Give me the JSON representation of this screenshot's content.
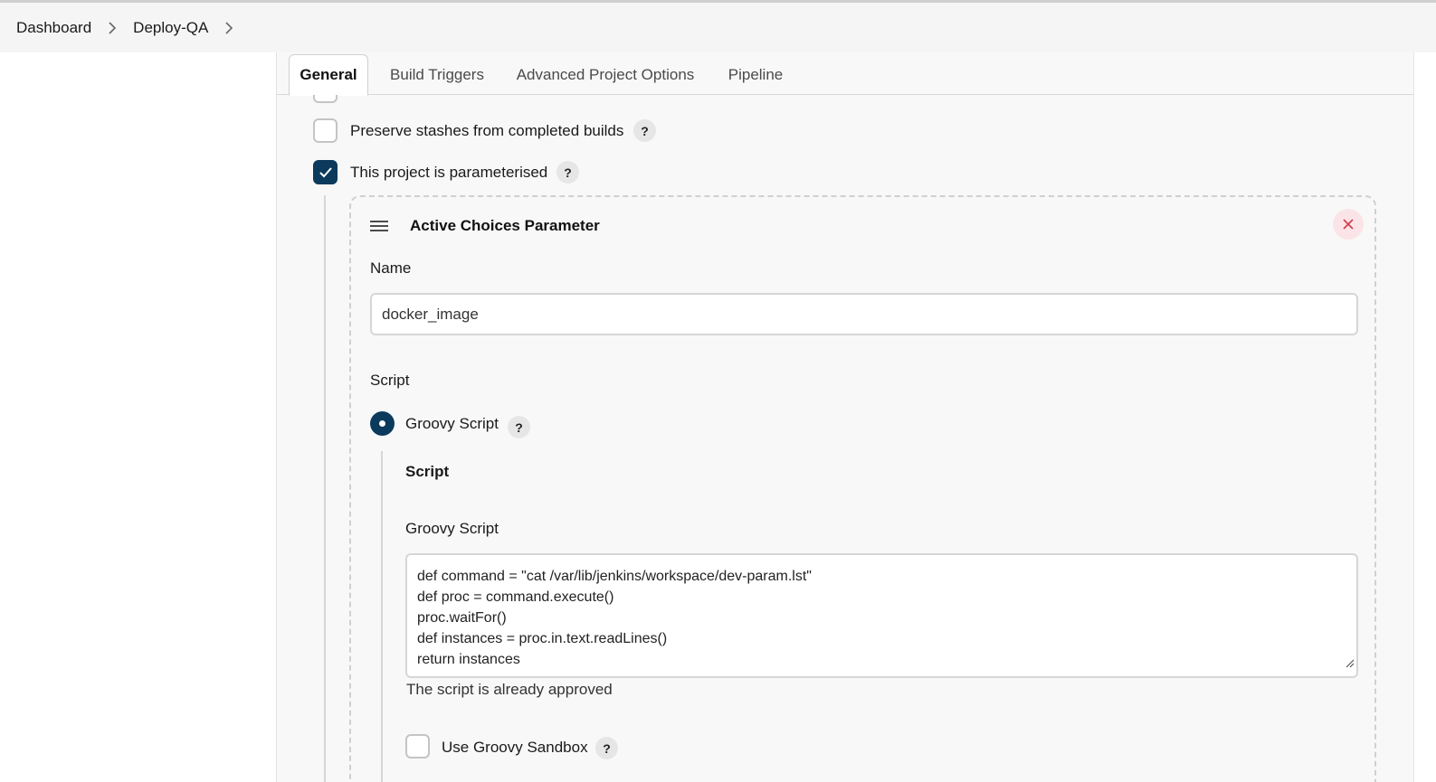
{
  "breadcrumb": {
    "items": [
      "Dashboard",
      "Deploy-QA"
    ]
  },
  "tabs": [
    {
      "label": "General",
      "active": true
    },
    {
      "label": "Build Triggers",
      "active": false
    },
    {
      "label": "Advanced Project Options",
      "active": false
    },
    {
      "label": "Pipeline",
      "active": false
    }
  ],
  "options": {
    "preserve_stashes": {
      "label": "Preserve stashes from completed builds",
      "checked": false
    },
    "parameterised": {
      "label": "This project is parameterised",
      "checked": true
    }
  },
  "parameter": {
    "title": "Active Choices Parameter",
    "name_label": "Name",
    "name_value": "docker_image",
    "script_label": "Script",
    "groovy_radio_label": "Groovy Script",
    "script_section_title": "Script",
    "groovy_script_label": "Groovy Script",
    "script_lines": [
      "def command = \"cat /var/lib/jenkins/workspace/dev-param.lst\"",
      "def proc = command.execute()",
      "proc.waitFor()",
      "def instances = proc.in.text.readLines()",
      "return instances"
    ],
    "approval_status": "The script is already approved",
    "sandbox": {
      "label": "Use Groovy Sandbox",
      "checked": false
    }
  },
  "help_symbol": "?",
  "colors": {
    "accent": "#0b3a5c",
    "close_bg": "#fbe4e7",
    "close_icon": "#d33a4a"
  },
  "icons": [
    "chevron-right-icon",
    "check-icon",
    "help-icon",
    "drag-handle-icon",
    "close-icon",
    "resize-grip-icon"
  ]
}
